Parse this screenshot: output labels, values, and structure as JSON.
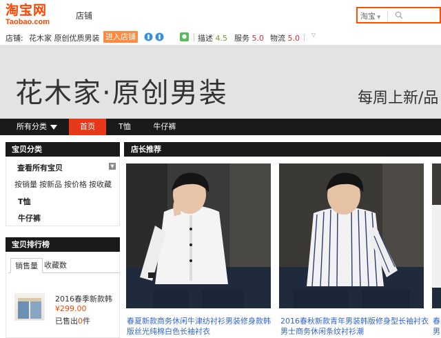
{
  "header": {
    "logo_cn": "淘宝网",
    "logo_en": "Taobao.com",
    "shop_tab": "店铺",
    "search": {
      "scope": "淘宝",
      "placeholder": ""
    }
  },
  "shopbar": {
    "label": "店铺:",
    "shop_name": "花木家 原创优质男装",
    "enter_button": "进入店铺",
    "desc_label": "描述",
    "desc_score": "4.5",
    "service_label": "服务",
    "service_score": "5.0",
    "logistics_label": "物流",
    "logistics_score": "5.0"
  },
  "banner": {
    "title": "花木家·原创男装",
    "subtitle": "每周上新/品"
  },
  "nav": {
    "items": [
      {
        "label": "所有分类"
      },
      {
        "label": "首页"
      },
      {
        "label": "T恤"
      },
      {
        "label": "牛仔裤"
      }
    ]
  },
  "sidebar": {
    "categories_title": "宝贝分类",
    "view_all": "查看所有宝贝",
    "sort_links": [
      "按销量",
      "按新品",
      "按价格",
      "按收藏"
    ],
    "category_items": [
      "T恤",
      "牛仔裤"
    ],
    "ranking_title": "宝贝排行榜",
    "ranking_tabs": [
      "销售量",
      "收藏数"
    ],
    "ranking_item": {
      "name": "2016春季新款韩",
      "price": "¥299.00",
      "sold_prefix": "已售出",
      "sold_count": "0",
      "sold_suffix": "件"
    }
  },
  "main": {
    "section_title": "店长推荐",
    "products": [
      {
        "caption_line1": "春夏新款商务休闲牛津纺衬衫男装修身款韩",
        "caption_line2": "版丝光纯棉白色长袖衬衣"
      },
      {
        "caption_line1": "2016春秋新款青年男装韩版修身型长袖衬衣",
        "caption_line2": "男士商务休闲条纹衬衫潮"
      },
      {
        "caption_line1": "春",
        "caption_line2": "男"
      }
    ]
  },
  "colors": {
    "brand": "#ff4400",
    "accent": "#e8381a",
    "dark_bar": "#1a1a1a",
    "link": "#3366cc",
    "score_green": "#6ca12b",
    "score_red": "#d03030"
  }
}
